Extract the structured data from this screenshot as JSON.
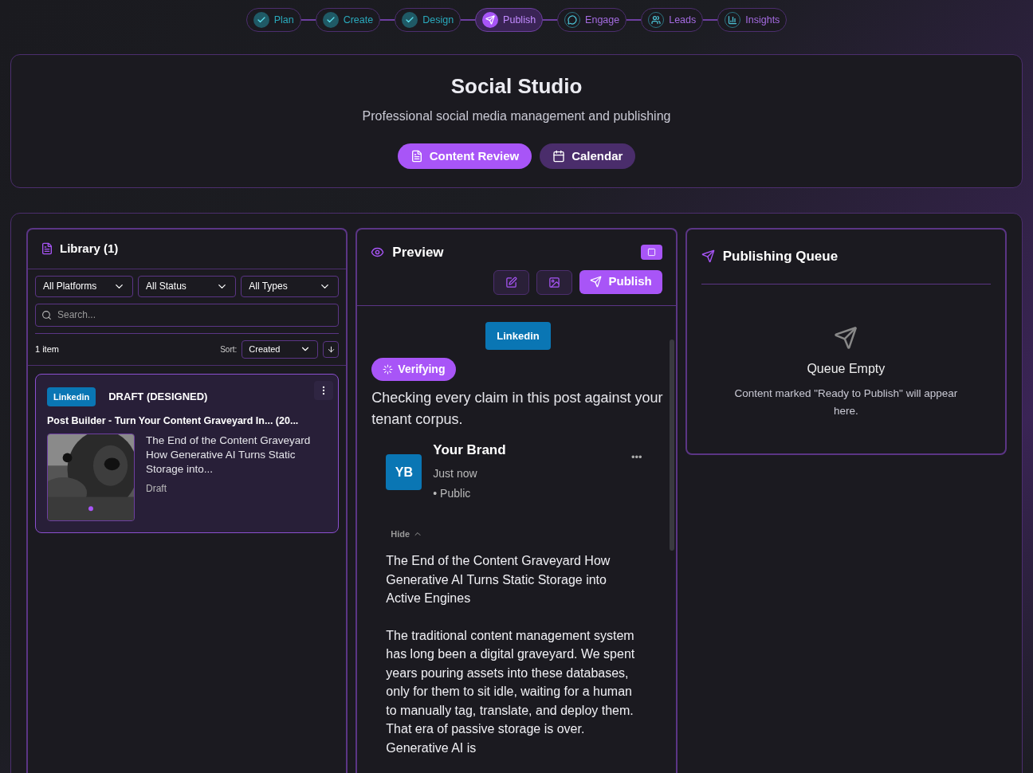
{
  "steps": [
    {
      "label": "Plan",
      "kind": "done"
    },
    {
      "label": "Create",
      "kind": "done"
    },
    {
      "label": "Design",
      "kind": "done"
    },
    {
      "label": "Publish",
      "kind": "current"
    },
    {
      "label": "Engage",
      "kind": "upcoming"
    },
    {
      "label": "Leads",
      "kind": "upcoming"
    },
    {
      "label": "Insights",
      "kind": "upcoming"
    }
  ],
  "header": {
    "title": "Social Studio",
    "subtitle": "Professional social media management and publishing",
    "tabs": [
      {
        "label": "Content Review",
        "selected": true
      },
      {
        "label": "Calendar",
        "selected": false
      }
    ]
  },
  "library": {
    "title": "Library (1)",
    "filters": [
      "All Platforms",
      "All Status",
      "All Types"
    ],
    "search": {
      "placeholder": "Search..."
    },
    "count": "1 item",
    "sort_label": "Sort:",
    "sort_value": "Created",
    "items": [
      {
        "platform": "Linkedin",
        "status": "DRAFT (DESIGNED)",
        "title": "Post Builder - Turn Your Content Graveyard In... (20...",
        "excerpt": "The End of the Content Graveyard How Generative AI Turns Static Storage into...",
        "state": "Draft"
      }
    ]
  },
  "preview": {
    "title": "Preview",
    "publish_label": "Publish",
    "platform": "Linkedin",
    "verify_badge": "Verifying",
    "verify_text": "Checking every claim in this post against your tenant corpus.",
    "post": {
      "avatar": "YB",
      "author": "Your Brand",
      "time": "Just now",
      "visibility": "• Public",
      "more": "•••",
      "toggle": "Hide",
      "paragraphs": [
        "The End of the Content Graveyard How Generative AI Turns Static Storage into Active Engines",
        "The traditional content management system has long been a digital graveyard. We spent years pouring assets into these databases, only for them to sit idle, waiting for a human to manually tag, translate, and deploy them. That era of passive storage is over. Generative AI is"
      ]
    }
  },
  "queue": {
    "title": "Publishing Queue",
    "empty_title": "Queue Empty",
    "empty_text": "Content marked \"Ready to Publish\" will appear here."
  }
}
